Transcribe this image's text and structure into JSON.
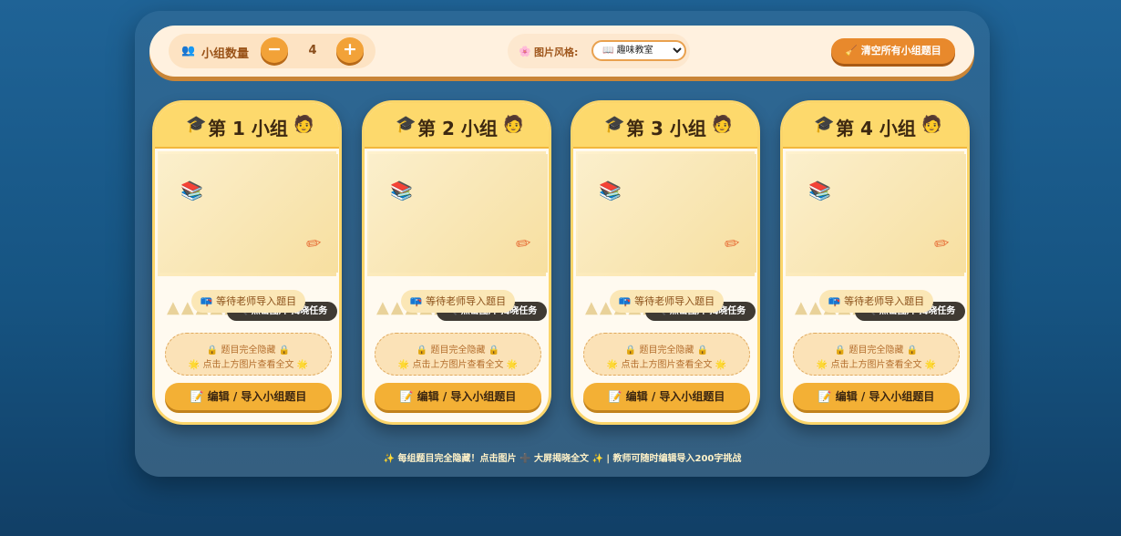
{
  "toolbar": {
    "group_count_label": "小组数量",
    "group_count_value": "4",
    "minus_label": "−",
    "plus_label": "+",
    "style_label": "图片风格:",
    "style_selected": "📖 趣味教室",
    "clear_button": "🧹 清空所有小组题目",
    "icons": {
      "group": "people-icon",
      "style": "palette-icon"
    }
  },
  "cards": [
    {
      "title": "第 1 小组",
      "reveal_tag": "🔍 点击图片 揭晓任务",
      "wait_badge": "等待老师导入题目",
      "hidden_line1": "🔒 题目完全隐藏 🔒",
      "hidden_line2": "🌟 点击上方图片查看全文 🌟",
      "edit_button": "📝 编辑 / 导入小组题目"
    },
    {
      "title": "第 2 小组",
      "reveal_tag": "🔍 点击图片 揭晓任务",
      "wait_badge": "等待老师导入题目",
      "hidden_line1": "🔒 题目完全隐藏 🔒",
      "hidden_line2": "🌟 点击上方图片查看全文 🌟",
      "edit_button": "📝 编辑 / 导入小组题目"
    },
    {
      "title": "第 3 小组",
      "reveal_tag": "🔍 点击图片 揭晓任务",
      "wait_badge": "等待老师导入题目",
      "hidden_line1": "🔒 题目完全隐藏 🔒",
      "hidden_line2": "🌟 点击上方图片查看全文 🌟",
      "edit_button": "📝 编辑 / 导入小组题目"
    },
    {
      "title": "第 4 小组",
      "reveal_tag": "🔍 点击图片 揭晓任务",
      "wait_badge": "等待老师导入题目",
      "hidden_line1": "🔒 题目完全隐藏 🔒",
      "hidden_line2": "🌟 点击上方图片查看全文 🌟",
      "edit_button": "📝 编辑 / 导入小组题目"
    }
  ],
  "footer": {
    "part1": "每组题目完全隐藏！点击图片",
    "part2": "大屏揭晓全文",
    "part3": "| 教师可随时编辑导入200字挑战"
  },
  "colors": {
    "background": "#1f6396",
    "toolbar": "#fff1df",
    "accent_orange": "#e8892c",
    "card_header": "#fdd96c",
    "edit_button": "#f3b035"
  }
}
